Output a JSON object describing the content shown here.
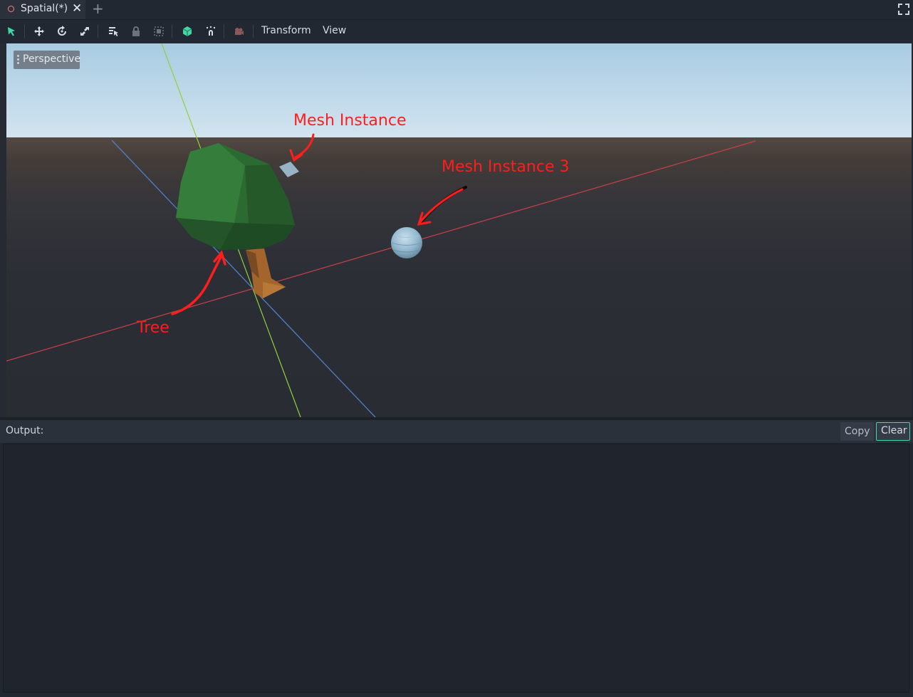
{
  "tabs": [
    {
      "label": "Spatial(*)",
      "icon": "spatial-node-icon"
    }
  ],
  "tabbar": {
    "close_icon": "close-icon",
    "add_icon": "plus-icon",
    "fullscreen_icon": "fullscreen-icon"
  },
  "toolbar": {
    "tools": [
      "select-tool-icon",
      "move-tool-icon",
      "rotate-tool-icon",
      "scale-tool-icon",
      "list-select-icon",
      "lock-icon",
      "group-icon",
      "local-space-icon",
      "snap-icon",
      "camera-icon"
    ],
    "menus": {
      "transform": "Transform",
      "view": "View"
    },
    "accent_color": "#41d6a3"
  },
  "viewport": {
    "mode_label": "Perspective",
    "annotations": {
      "mesh_instance": "Mesh Instance",
      "mesh_instance_3": "Mesh Instance 3",
      "tree": "Tree"
    },
    "annotation_color": "#ff1d1d"
  },
  "output": {
    "label": "Output:",
    "copy_label": "Copy",
    "clear_label": "Clear",
    "content": ""
  }
}
